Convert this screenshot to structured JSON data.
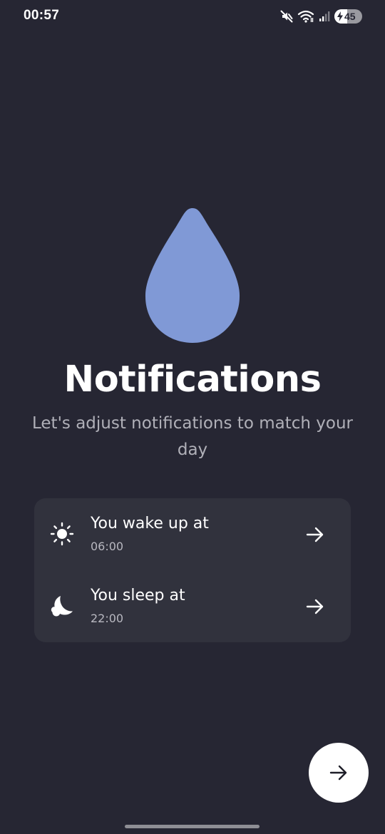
{
  "status_bar": {
    "time": "00:57",
    "battery_level": "45",
    "battery_fraction": 0.45,
    "icons": [
      "mute-icon",
      "wifi-icon",
      "signal-icon",
      "battery-charging-icon"
    ]
  },
  "hero": {
    "icon": "water-drop-icon",
    "icon_color": "#8099d6",
    "title": "Notifications",
    "subtitle": "Let's adjust notifications to match your day"
  },
  "schedule": {
    "items": [
      {
        "icon": "sun-icon",
        "label": "You wake up at",
        "value": "06:00",
        "arrow_icon": "arrow-right-icon"
      },
      {
        "icon": "moon-icon",
        "label": "You sleep at",
        "value": "22:00",
        "arrow_icon": "arrow-right-icon"
      }
    ]
  },
  "next_button": {
    "icon": "arrow-right-icon"
  },
  "colors": {
    "background": "#262633",
    "card": "#31323d",
    "accent": "#8099d6",
    "subtitle_text": "#b0b0b8"
  }
}
